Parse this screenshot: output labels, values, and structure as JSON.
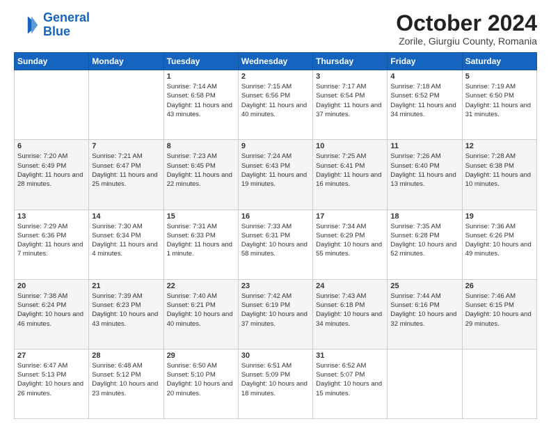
{
  "header": {
    "logo_line1": "General",
    "logo_line2": "Blue",
    "month": "October 2024",
    "location": "Zorile, Giurgiu County, Romania"
  },
  "weekdays": [
    "Sunday",
    "Monday",
    "Tuesday",
    "Wednesday",
    "Thursday",
    "Friday",
    "Saturday"
  ],
  "weeks": [
    [
      {
        "day": "",
        "info": ""
      },
      {
        "day": "",
        "info": ""
      },
      {
        "day": "1",
        "info": "Sunrise: 7:14 AM\nSunset: 6:58 PM\nDaylight: 11 hours and 43 minutes."
      },
      {
        "day": "2",
        "info": "Sunrise: 7:15 AM\nSunset: 6:56 PM\nDaylight: 11 hours and 40 minutes."
      },
      {
        "day": "3",
        "info": "Sunrise: 7:17 AM\nSunset: 6:54 PM\nDaylight: 11 hours and 37 minutes."
      },
      {
        "day": "4",
        "info": "Sunrise: 7:18 AM\nSunset: 6:52 PM\nDaylight: 11 hours and 34 minutes."
      },
      {
        "day": "5",
        "info": "Sunrise: 7:19 AM\nSunset: 6:50 PM\nDaylight: 11 hours and 31 minutes."
      }
    ],
    [
      {
        "day": "6",
        "info": "Sunrise: 7:20 AM\nSunset: 6:49 PM\nDaylight: 11 hours and 28 minutes."
      },
      {
        "day": "7",
        "info": "Sunrise: 7:21 AM\nSunset: 6:47 PM\nDaylight: 11 hours and 25 minutes."
      },
      {
        "day": "8",
        "info": "Sunrise: 7:23 AM\nSunset: 6:45 PM\nDaylight: 11 hours and 22 minutes."
      },
      {
        "day": "9",
        "info": "Sunrise: 7:24 AM\nSunset: 6:43 PM\nDaylight: 11 hours and 19 minutes."
      },
      {
        "day": "10",
        "info": "Sunrise: 7:25 AM\nSunset: 6:41 PM\nDaylight: 11 hours and 16 minutes."
      },
      {
        "day": "11",
        "info": "Sunrise: 7:26 AM\nSunset: 6:40 PM\nDaylight: 11 hours and 13 minutes."
      },
      {
        "day": "12",
        "info": "Sunrise: 7:28 AM\nSunset: 6:38 PM\nDaylight: 11 hours and 10 minutes."
      }
    ],
    [
      {
        "day": "13",
        "info": "Sunrise: 7:29 AM\nSunset: 6:36 PM\nDaylight: 11 hours and 7 minutes."
      },
      {
        "day": "14",
        "info": "Sunrise: 7:30 AM\nSunset: 6:34 PM\nDaylight: 11 hours and 4 minutes."
      },
      {
        "day": "15",
        "info": "Sunrise: 7:31 AM\nSunset: 6:33 PM\nDaylight: 11 hours and 1 minute."
      },
      {
        "day": "16",
        "info": "Sunrise: 7:33 AM\nSunset: 6:31 PM\nDaylight: 10 hours and 58 minutes."
      },
      {
        "day": "17",
        "info": "Sunrise: 7:34 AM\nSunset: 6:29 PM\nDaylight: 10 hours and 55 minutes."
      },
      {
        "day": "18",
        "info": "Sunrise: 7:35 AM\nSunset: 6:28 PM\nDaylight: 10 hours and 52 minutes."
      },
      {
        "day": "19",
        "info": "Sunrise: 7:36 AM\nSunset: 6:26 PM\nDaylight: 10 hours and 49 minutes."
      }
    ],
    [
      {
        "day": "20",
        "info": "Sunrise: 7:38 AM\nSunset: 6:24 PM\nDaylight: 10 hours and 46 minutes."
      },
      {
        "day": "21",
        "info": "Sunrise: 7:39 AM\nSunset: 6:23 PM\nDaylight: 10 hours and 43 minutes."
      },
      {
        "day": "22",
        "info": "Sunrise: 7:40 AM\nSunset: 6:21 PM\nDaylight: 10 hours and 40 minutes."
      },
      {
        "day": "23",
        "info": "Sunrise: 7:42 AM\nSunset: 6:19 PM\nDaylight: 10 hours and 37 minutes."
      },
      {
        "day": "24",
        "info": "Sunrise: 7:43 AM\nSunset: 6:18 PM\nDaylight: 10 hours and 34 minutes."
      },
      {
        "day": "25",
        "info": "Sunrise: 7:44 AM\nSunset: 6:16 PM\nDaylight: 10 hours and 32 minutes."
      },
      {
        "day": "26",
        "info": "Sunrise: 7:46 AM\nSunset: 6:15 PM\nDaylight: 10 hours and 29 minutes."
      }
    ],
    [
      {
        "day": "27",
        "info": "Sunrise: 6:47 AM\nSunset: 5:13 PM\nDaylight: 10 hours and 26 minutes."
      },
      {
        "day": "28",
        "info": "Sunrise: 6:48 AM\nSunset: 5:12 PM\nDaylight: 10 hours and 23 minutes."
      },
      {
        "day": "29",
        "info": "Sunrise: 6:50 AM\nSunset: 5:10 PM\nDaylight: 10 hours and 20 minutes."
      },
      {
        "day": "30",
        "info": "Sunrise: 6:51 AM\nSunset: 5:09 PM\nDaylight: 10 hours and 18 minutes."
      },
      {
        "day": "31",
        "info": "Sunrise: 6:52 AM\nSunset: 5:07 PM\nDaylight: 10 hours and 15 minutes."
      },
      {
        "day": "",
        "info": ""
      },
      {
        "day": "",
        "info": ""
      }
    ]
  ]
}
